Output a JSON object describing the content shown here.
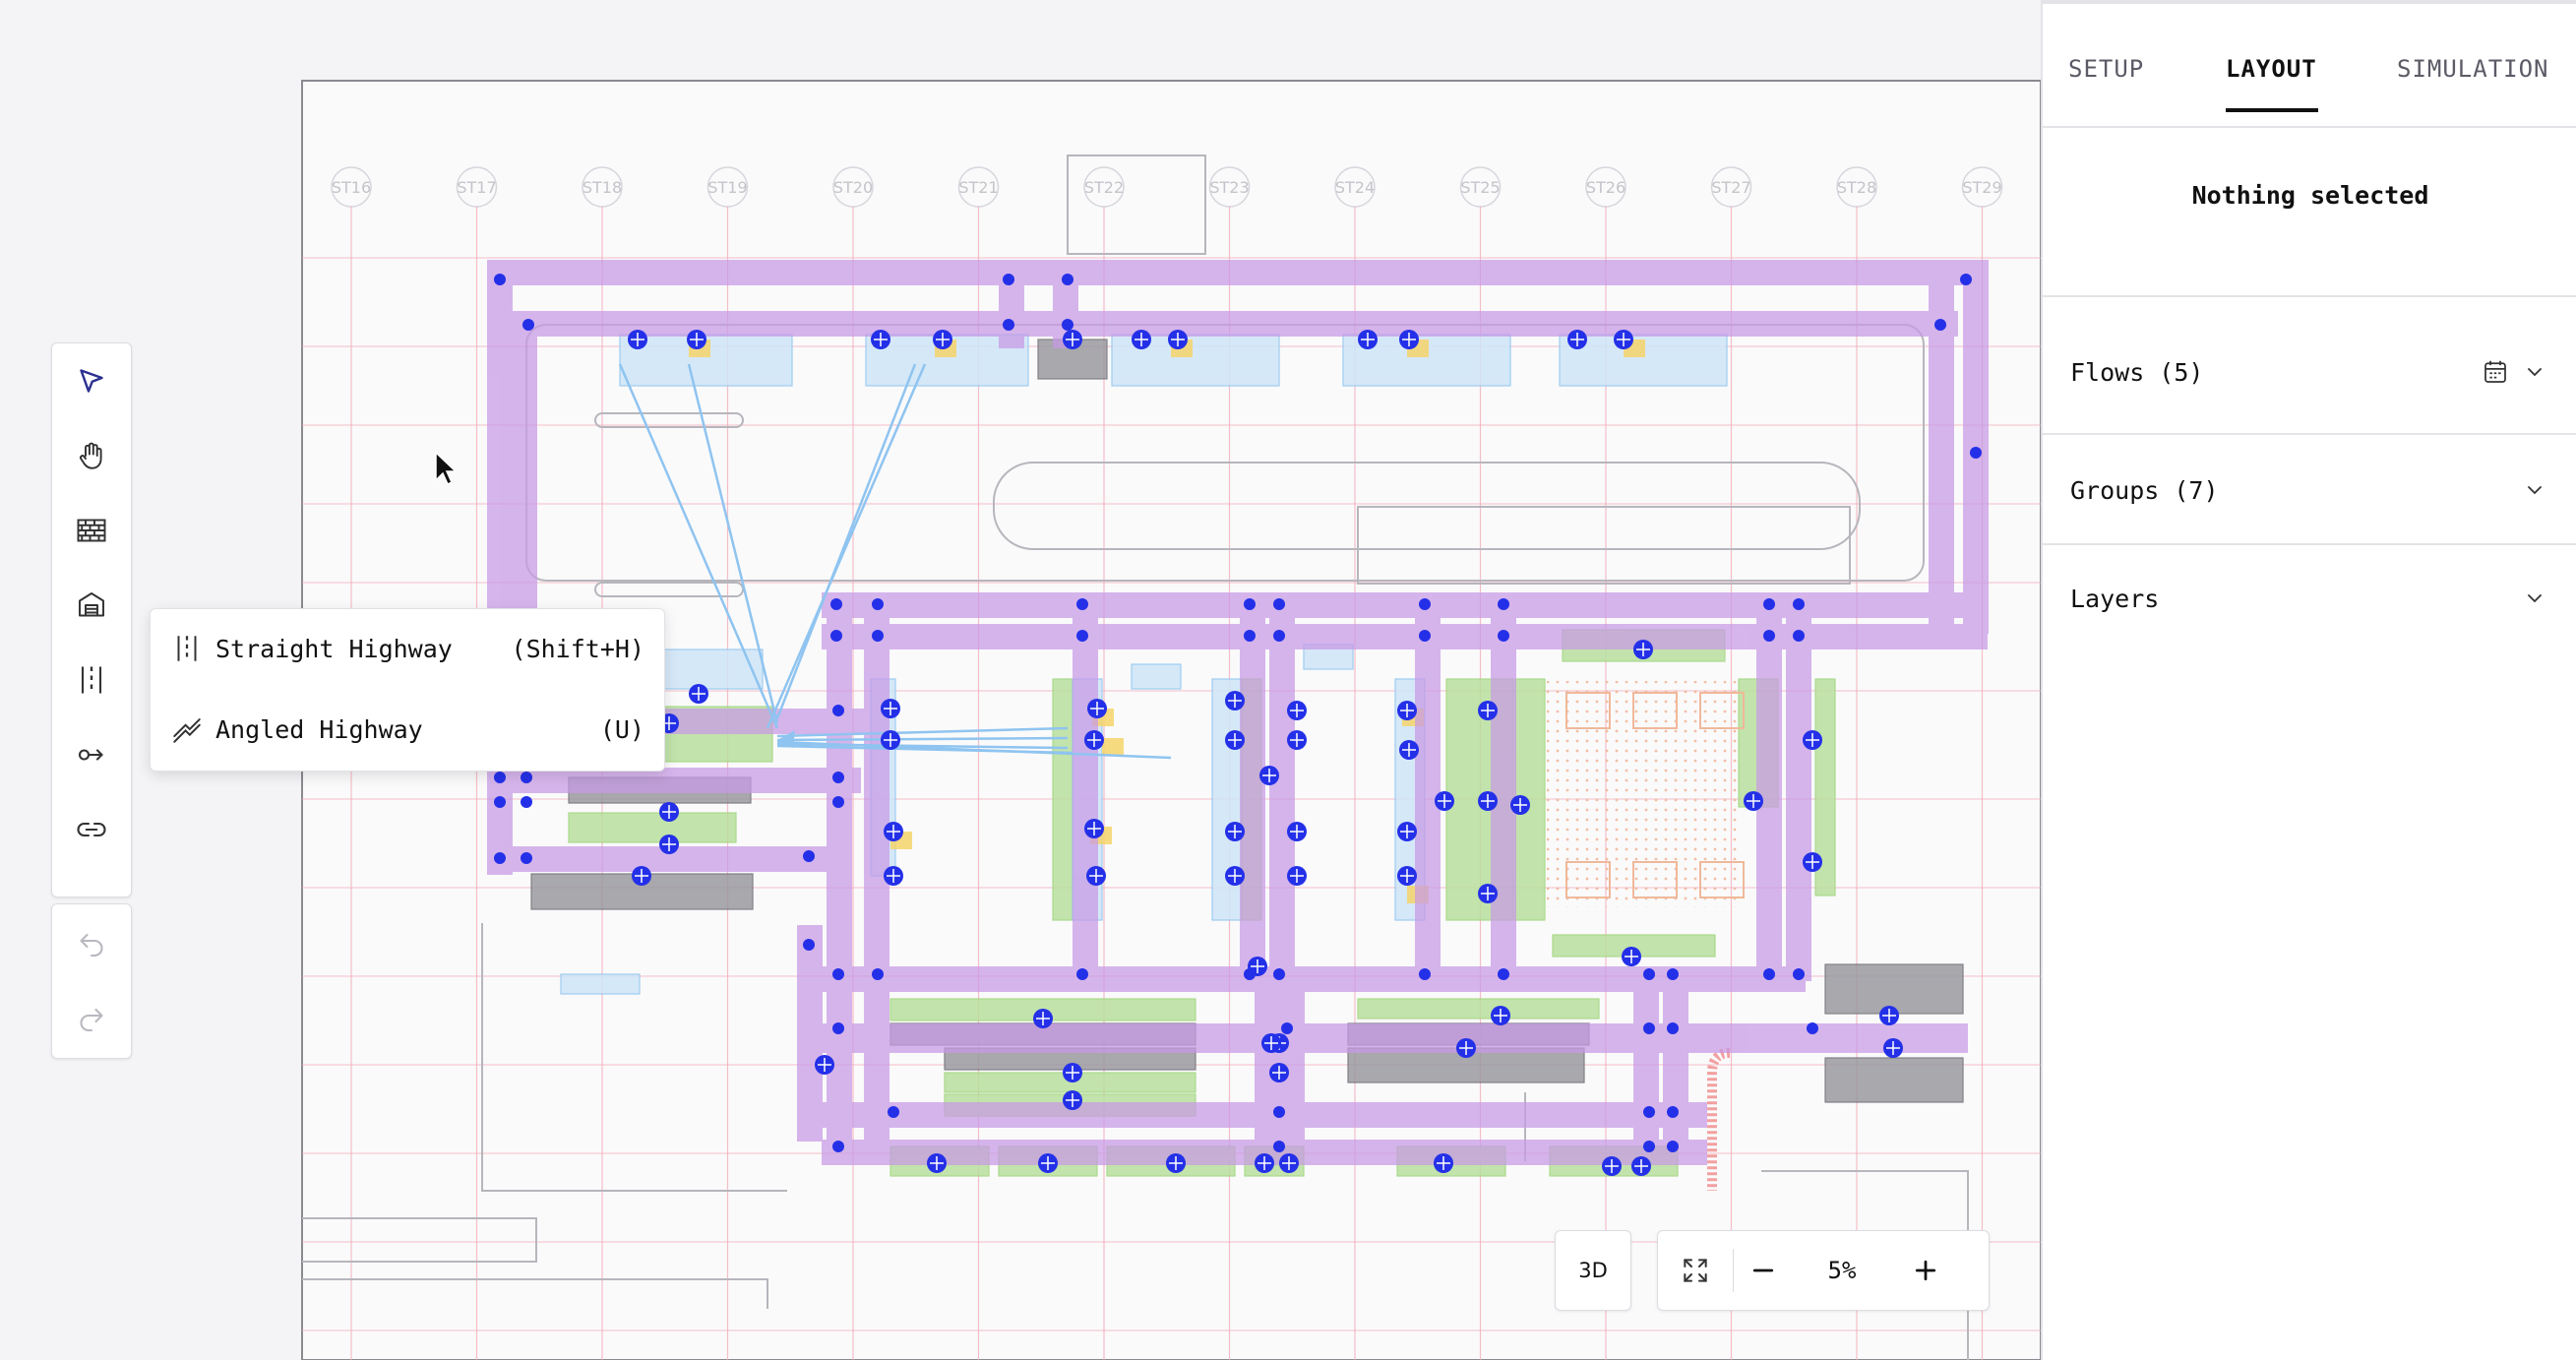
{
  "canvas": {
    "station_labels": [
      "ST16",
      "ST17",
      "ST18",
      "ST19",
      "ST20",
      "ST21",
      "ST22",
      "ST23",
      "ST24",
      "ST25",
      "ST26",
      "ST27",
      "ST28",
      "ST29"
    ],
    "colors": {
      "highway": "#c89ae6",
      "highway_node": "#2430e8",
      "gridline": "#f2a9b6",
      "conveyor_green": "#9ed47a",
      "rack_blue": "#8fc4ef",
      "equipment_gray": "#8a8a8a",
      "flow_arrow": "#8fc4f0",
      "hatch_orange": "#f0b89a"
    }
  },
  "toolbar": {
    "tools": [
      {
        "icon": "select-pointer-icon",
        "active": true
      },
      {
        "icon": "hand-pan-icon",
        "active": false
      },
      {
        "icon": "wall-brick-icon",
        "active": false
      },
      {
        "icon": "warehouse-icon",
        "active": false
      },
      {
        "icon": "highway-icon",
        "active": false
      },
      {
        "icon": "connector-icon",
        "active": false
      },
      {
        "icon": "link-icon",
        "active": false
      }
    ],
    "history": [
      {
        "icon": "undo-icon",
        "enabled": false
      },
      {
        "icon": "redo-icon",
        "enabled": false
      }
    ]
  },
  "highway_menu": {
    "items": [
      {
        "icon": "straight-highway-icon",
        "label": "Straight Highway",
        "shortcut": "(Shift+H)"
      },
      {
        "icon": "angled-highway-icon",
        "label": "Angled Highway",
        "shortcut": "(U)"
      }
    ]
  },
  "view_controls": {
    "three_d_label": "3D",
    "zoom_level": "5%",
    "fit_icon": "fit-screen-icon",
    "zoom_out_icon": "minus-icon",
    "zoom_in_icon": "plus-icon"
  },
  "panel": {
    "tabs": [
      {
        "label": "SETUP",
        "active": false
      },
      {
        "label": "LAYOUT",
        "active": true
      },
      {
        "label": "SIMULATION",
        "active": false
      }
    ],
    "selection": "Nothing selected",
    "sections": [
      {
        "label": "Flows (5)",
        "icon": "calendar-icon"
      },
      {
        "label": "Groups (7)"
      },
      {
        "label": "Layers"
      }
    ]
  }
}
